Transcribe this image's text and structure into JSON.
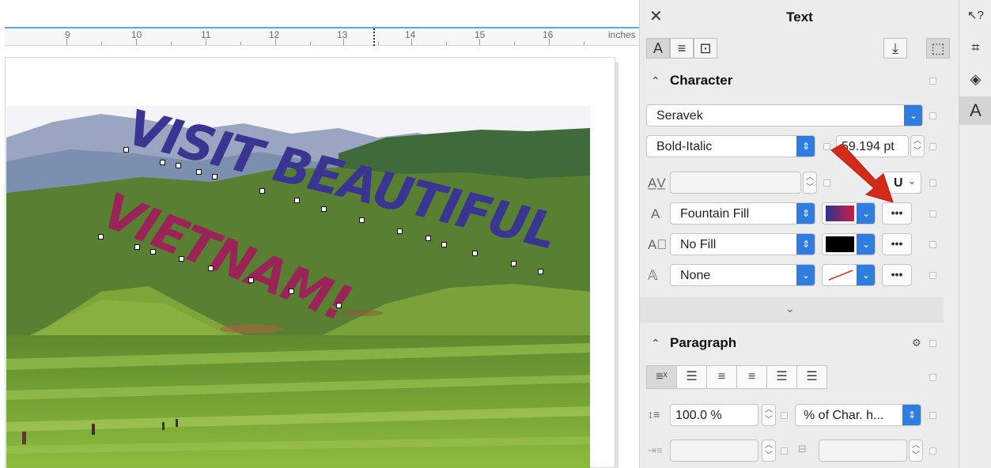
{
  "ruler": {
    "labels": [
      "9",
      "10",
      "11",
      "12",
      "13",
      "14",
      "15",
      "16",
      "inches"
    ]
  },
  "artwork": {
    "line1": "VISIT BEAUTIFUL",
    "line2": "VIETNAM!",
    "gradient_start": "#2b3590",
    "gradient_end": "#d01c45"
  },
  "docker": {
    "title": "Text",
    "close_icon": "close-icon",
    "tabs": [
      "character-tab-icon",
      "paragraph-tab-icon",
      "frame-tab-icon"
    ],
    "character": {
      "header": "Character",
      "font_family": "Seravek",
      "font_style": "Bold-Italic",
      "font_size": "59.194 pt",
      "kerning_value": "",
      "underline_label": "U",
      "fill_type": "Fountain Fill",
      "outline_type": "No Fill",
      "background_type": "None",
      "more_label": "•••"
    },
    "paragraph": {
      "header": "Paragraph",
      "line_spacing": "100.0 %",
      "spacing_unit": "% of Char. h...",
      "indent_value": "",
      "spacing_value": ""
    }
  },
  "right_toolbar": {
    "items": [
      "hints-icon",
      "object-properties-icon",
      "layers-icon",
      "text-icon"
    ]
  },
  "colors": {
    "accent": "#2f7de1",
    "annotation_arrow": "#d42a1a"
  }
}
